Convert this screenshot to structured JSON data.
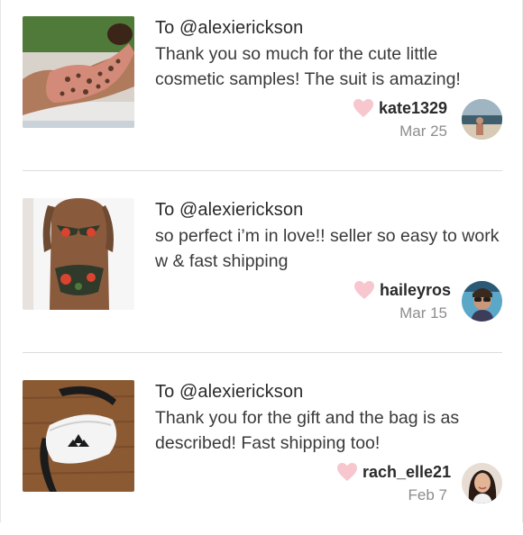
{
  "reviews": [
    {
      "to": "To @alexierickson",
      "message": "Thank you so much for the cute little cosmetic samples! The suit is amazing!",
      "username": "kate1329",
      "date": "Mar 25",
      "thumbnail_icon": "leopard-swimsuit-photo",
      "avatar_icon": "beach-avatar"
    },
    {
      "to": "To @alexierickson",
      "message": "so perfect i’m in love!! seller so easy to work w & fast shipping",
      "username": "haileyros",
      "date": "Mar 15",
      "thumbnail_icon": "floral-bikini-photo",
      "avatar_icon": "sunglasses-avatar"
    },
    {
      "to": "To @alexierickson",
      "message": "Thank you for the gift and the bag is as described! Fast shipping too!",
      "username": "rach_elle21",
      "date": "Feb 7",
      "thumbnail_icon": "belt-bag-photo",
      "avatar_icon": "portrait-avatar"
    }
  ],
  "colors": {
    "heart": "#f7c6cf",
    "divider": "#dcdcdc",
    "date": "#8c8c8c"
  }
}
